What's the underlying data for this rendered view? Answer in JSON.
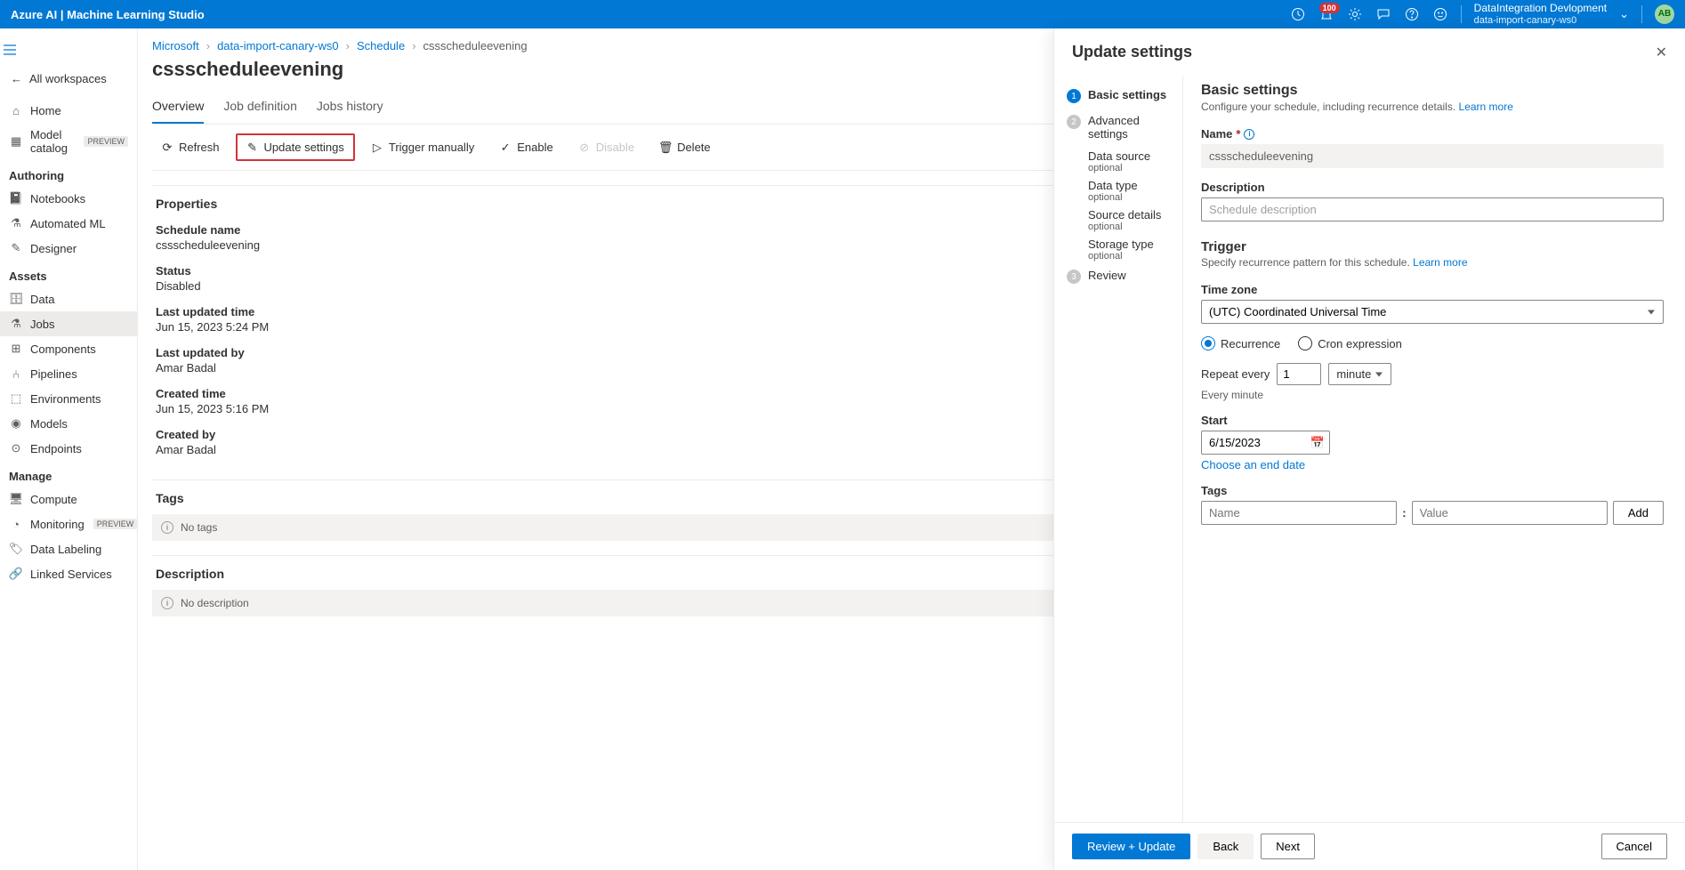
{
  "topbar": {
    "title": "Azure AI | Machine Learning Studio",
    "badge": "100",
    "tenant": "DataIntegration Devlopment",
    "workspace": "data-import-canary-ws0",
    "avatar": "AB"
  },
  "leftnav": {
    "back": "All workspaces",
    "items_top": [
      {
        "label": "Home",
        "icon": "home"
      },
      {
        "label": "Model catalog",
        "icon": "catalog",
        "preview": "PREVIEW"
      }
    ],
    "section_authoring": "Authoring",
    "items_authoring": [
      {
        "label": "Notebooks",
        "icon": "notebook"
      },
      {
        "label": "Automated ML",
        "icon": "automl"
      },
      {
        "label": "Designer",
        "icon": "designer"
      }
    ],
    "section_assets": "Assets",
    "items_assets": [
      {
        "label": "Data",
        "icon": "data"
      },
      {
        "label": "Jobs",
        "icon": "jobs",
        "active": true
      },
      {
        "label": "Components",
        "icon": "components"
      },
      {
        "label": "Pipelines",
        "icon": "pipelines"
      },
      {
        "label": "Environments",
        "icon": "env"
      },
      {
        "label": "Models",
        "icon": "models"
      },
      {
        "label": "Endpoints",
        "icon": "endpoints"
      }
    ],
    "section_manage": "Manage",
    "items_manage": [
      {
        "label": "Compute",
        "icon": "compute"
      },
      {
        "label": "Monitoring",
        "icon": "monitor",
        "preview": "PREVIEW"
      },
      {
        "label": "Data Labeling",
        "icon": "labeling"
      },
      {
        "label": "Linked Services",
        "icon": "linked"
      }
    ]
  },
  "breadcrumb": [
    "Microsoft",
    "data-import-canary-ws0",
    "Schedule",
    "cssscheduleevening"
  ],
  "page_title": "cssscheduleevening",
  "tabs": [
    "Overview",
    "Job definition",
    "Jobs history"
  ],
  "toolbar": {
    "refresh": "Refresh",
    "update_settings": "Update settings",
    "trigger": "Trigger manually",
    "enable": "Enable",
    "disable": "Disable",
    "delete": "Delete"
  },
  "properties": {
    "heading": "Properties",
    "rows": [
      {
        "label": "Schedule name",
        "value": "cssscheduleevening"
      },
      {
        "label": "Status",
        "value": "Disabled"
      },
      {
        "label": "Last updated time",
        "value": "Jun 15, 2023 5:24 PM"
      },
      {
        "label": "Last updated by",
        "value": "Amar Badal"
      },
      {
        "label": "Created time",
        "value": "Jun 15, 2023 5:16 PM"
      },
      {
        "label": "Created by",
        "value": "Amar Badal"
      }
    ]
  },
  "tags": {
    "heading": "Tags",
    "empty": "No tags"
  },
  "description": {
    "heading": "Description",
    "empty": "No description"
  },
  "panel": {
    "title": "Update settings",
    "wizard": {
      "step1": "Basic settings",
      "step2": "Advanced settings",
      "subs": [
        {
          "label": "Data source",
          "opt": "optional"
        },
        {
          "label": "Data type",
          "opt": "optional"
        },
        {
          "label": "Source details",
          "opt": "optional"
        },
        {
          "label": "Storage type",
          "opt": "optional"
        }
      ],
      "step3": "Review"
    },
    "form": {
      "heading": "Basic settings",
      "subtext": "Configure your schedule, including recurrence details.",
      "learn": "Learn more",
      "name_label": "Name",
      "name_value": "cssscheduleevening",
      "desc_label": "Description",
      "desc_placeholder": "Schedule description",
      "trigger_heading": "Trigger",
      "trigger_sub": "Specify recurrence pattern for this schedule.",
      "tz_label": "Time zone",
      "tz_value": "(UTC) Coordinated Universal Time",
      "radio_recurrence": "Recurrence",
      "radio_cron": "Cron expression",
      "repeat_label": "Repeat every",
      "repeat_value": "1",
      "repeat_unit": "minute",
      "repeat_summary": "Every minute",
      "start_label": "Start",
      "start_value": "6/15/2023",
      "end_link": "Choose an end date",
      "tags_label": "Tags",
      "tag_name_ph": "Name",
      "tag_value_ph": "Value",
      "add": "Add"
    },
    "footer": {
      "primary": "Review + Update",
      "back": "Back",
      "next": "Next",
      "cancel": "Cancel"
    }
  }
}
